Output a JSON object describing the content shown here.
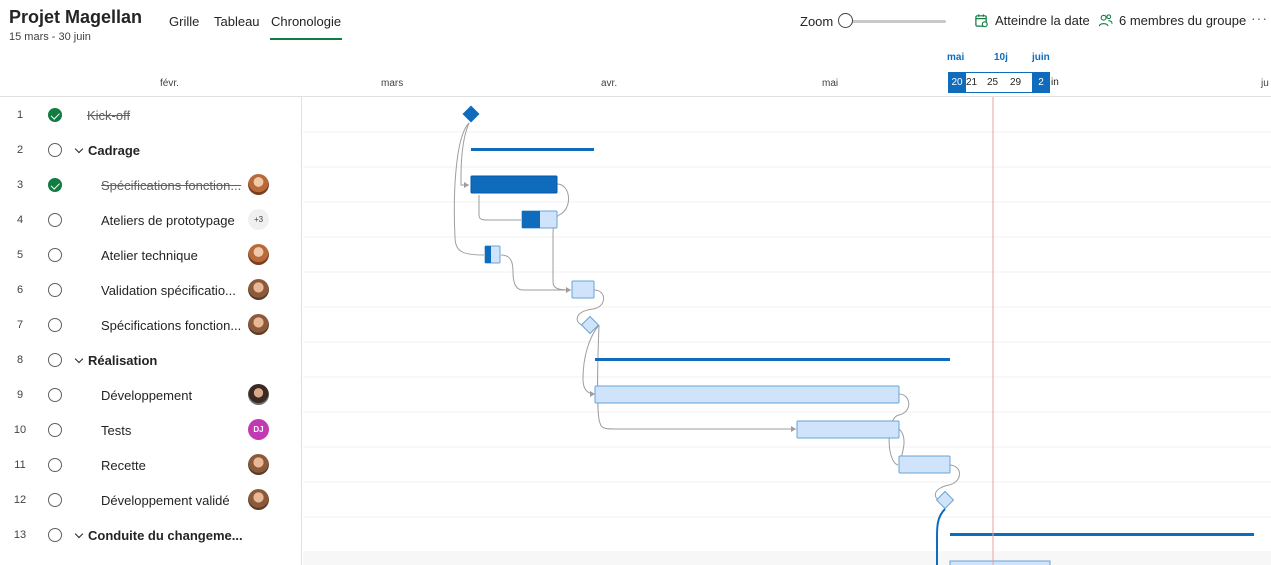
{
  "header": {
    "title": "Projet Magellan",
    "dates": "15 mars - 30 juin",
    "tabs": [
      "Grille",
      "Tableau",
      "Chronologie"
    ],
    "active_tab": "Chronologie",
    "zoom_label": "Zoom",
    "goto_label": "Atteindre la date",
    "members_label": "6 membres du groupe",
    "more": "···"
  },
  "axis": {
    "months": [
      "févr.",
      "mars",
      "avr.",
      "mai",
      "juin",
      "ju"
    ],
    "range_top_left": "mai",
    "range_top_mid": "10j",
    "range_top_right": "juin",
    "range_start": "20",
    "range_end": "2",
    "range_ticks": [
      "21",
      "25",
      "29"
    ],
    "after_range": "in"
  },
  "tasks": [
    {
      "num": "1",
      "name": "Kick-off",
      "done": true,
      "group": false,
      "avatar": ""
    },
    {
      "num": "2",
      "name": "Cadrage",
      "done": false,
      "group": true,
      "avatar": ""
    },
    {
      "num": "3",
      "name": "Spécifications fonction...",
      "done": true,
      "group": false,
      "avatar": "a"
    },
    {
      "num": "4",
      "name": "Ateliers de prototypage",
      "done": false,
      "group": false,
      "avatar": "+3"
    },
    {
      "num": "5",
      "name": "Atelier technique",
      "done": false,
      "group": false,
      "avatar": "a"
    },
    {
      "num": "6",
      "name": "Validation spécificatio...",
      "done": false,
      "group": false,
      "avatar": "b"
    },
    {
      "num": "7",
      "name": "Spécifications fonction...",
      "done": false,
      "group": false,
      "avatar": "b"
    },
    {
      "num": "8",
      "name": "Réalisation",
      "done": false,
      "group": true,
      "avatar": ""
    },
    {
      "num": "9",
      "name": "Développement",
      "done": false,
      "group": false,
      "avatar": "c"
    },
    {
      "num": "10",
      "name": "Tests",
      "done": false,
      "group": false,
      "avatar": "DJ"
    },
    {
      "num": "11",
      "name": "Recette",
      "done": false,
      "group": false,
      "avatar": "b"
    },
    {
      "num": "12",
      "name": "Développement validé",
      "done": false,
      "group": false,
      "avatar": "b"
    },
    {
      "num": "13",
      "name": "Conduite du changeme...",
      "done": false,
      "group": true,
      "avatar": ""
    }
  ],
  "colors": {
    "accent": "#0f6cbd",
    "done_green": "#107c41",
    "today_line": "#e8a0a0",
    "bar_light": "#cfe4fa"
  }
}
